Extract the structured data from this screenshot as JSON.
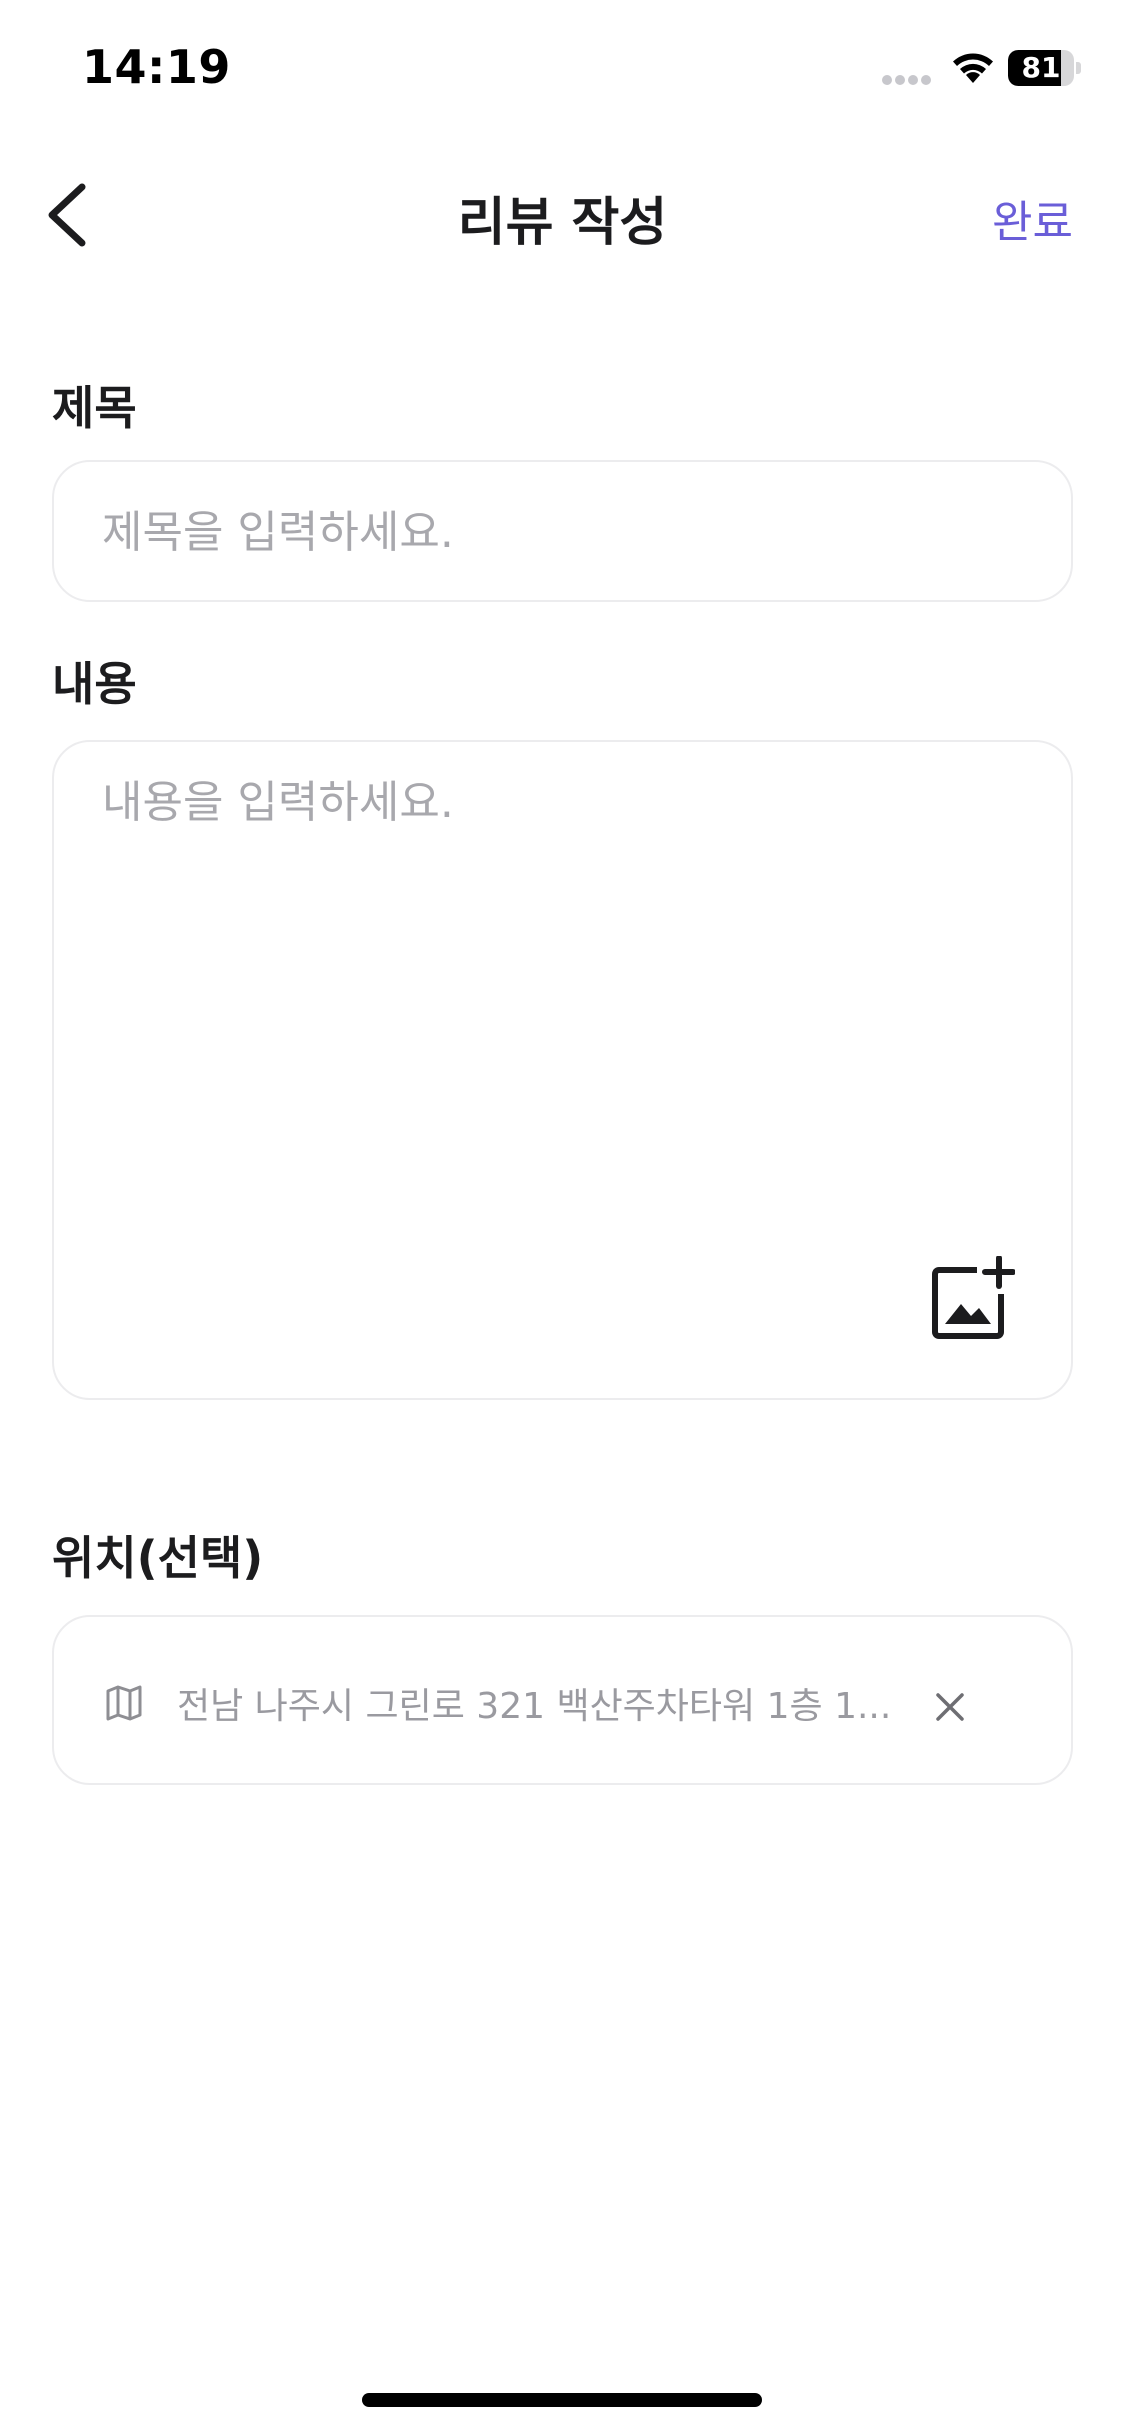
{
  "status_bar": {
    "time": "14:19",
    "battery_level": "81",
    "battery_fraction": 0.81
  },
  "nav": {
    "back_icon": "chevron-left-icon",
    "title": "리뷰 작성",
    "done_label": "완료"
  },
  "form": {
    "title_label": "제목",
    "title_value": "",
    "title_placeholder": "제목을 입력하세요.",
    "content_label": "내용",
    "content_value": "",
    "content_placeholder": "내용을 입력하세요.",
    "add_photo_icon": "add-photo-icon",
    "location_label": "위치(선택)",
    "location_value": "전남 나주시 그린로 321 백산주차타워 1층 1...",
    "location_icon": "map-icon",
    "clear_icon": "close-icon"
  },
  "colors": {
    "accent": "#6a5ed8",
    "text_primary": "#1c1c1e",
    "placeholder": "#a8a8ad",
    "border": "#ececee",
    "location_text": "#9a9aa0"
  }
}
